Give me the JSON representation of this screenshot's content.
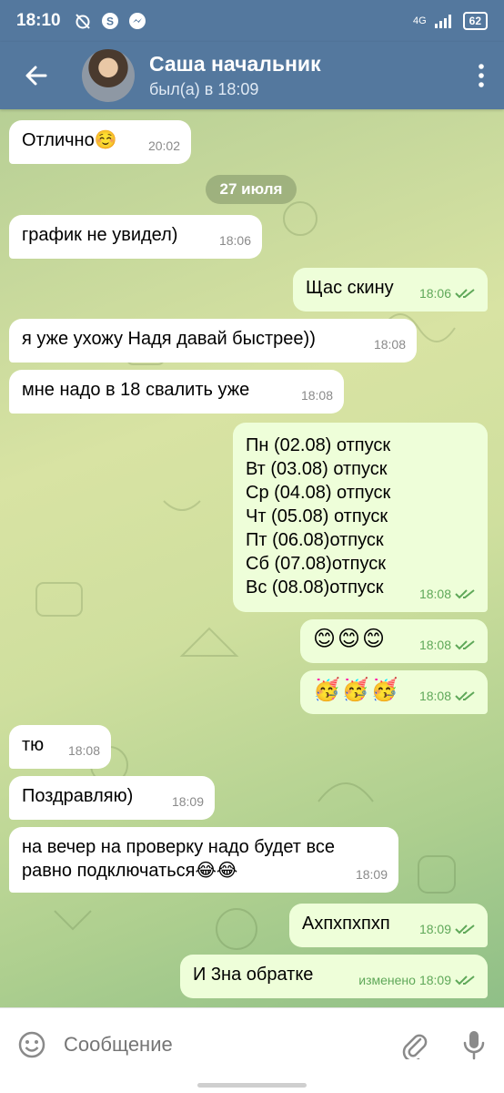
{
  "status_bar": {
    "time": "18:10",
    "network": "4G",
    "battery": "62"
  },
  "header": {
    "contact_name": "Саша начальник",
    "contact_status": "был(а) в 18:09"
  },
  "date_chip": "27 июля",
  "messages": [
    {
      "dir": "in",
      "text": "Отлично☺️",
      "time": "20:02"
    },
    {
      "dir": "in",
      "text": "график не увидел)",
      "time": "18:06"
    },
    {
      "dir": "out",
      "text": "Щас скину",
      "time": "18:06"
    },
    {
      "dir": "in",
      "text": "я уже ухожу Надя давай быстрее))",
      "time": "18:08"
    },
    {
      "dir": "in",
      "text": "мне надо в 18 свалить уже",
      "time": "18:08"
    },
    {
      "dir": "out",
      "lines": [
        "Пн (02.08) отпуск",
        "Вт (03.08) отпуск",
        "Ср (04.08) отпуск",
        "Чт (05.08) отпуск",
        "Пт (06.08)отпуск",
        "Сб (07.08)отпуск",
        "Вс (08.08)отпуск"
      ],
      "time": "18:08"
    },
    {
      "dir": "out",
      "text": "😊😊😊",
      "time": "18:08"
    },
    {
      "dir": "out",
      "text": "🥳🥳🥳",
      "time": "18:08"
    },
    {
      "dir": "in",
      "text": "тю",
      "time": "18:08"
    },
    {
      "dir": "in",
      "text": "Поздравляю)",
      "time": "18:09"
    },
    {
      "dir": "in",
      "lines": [
        "на вечер на проверку надо будет все",
        "равно подключаться😂😂"
      ],
      "time": "18:09"
    },
    {
      "dir": "out",
      "text": "Ахпхпхпхп",
      "time": "18:09"
    },
    {
      "dir": "out",
      "text": "И 3на обратке",
      "edited": "изменено",
      "time": "18:09"
    }
  ],
  "input": {
    "placeholder": "Сообщение"
  },
  "icons": {
    "back": "arrow-left-icon",
    "menu": "more-vertical-icon",
    "emoji": "smiley-icon",
    "attach": "paperclip-icon",
    "mic": "microphone-icon",
    "read": "double-check-icon"
  },
  "colors": {
    "header": "#54789e",
    "incoming_bubble": "#ffffff",
    "outgoing_bubble": "#eefed9",
    "read_check": "#5fa859"
  }
}
